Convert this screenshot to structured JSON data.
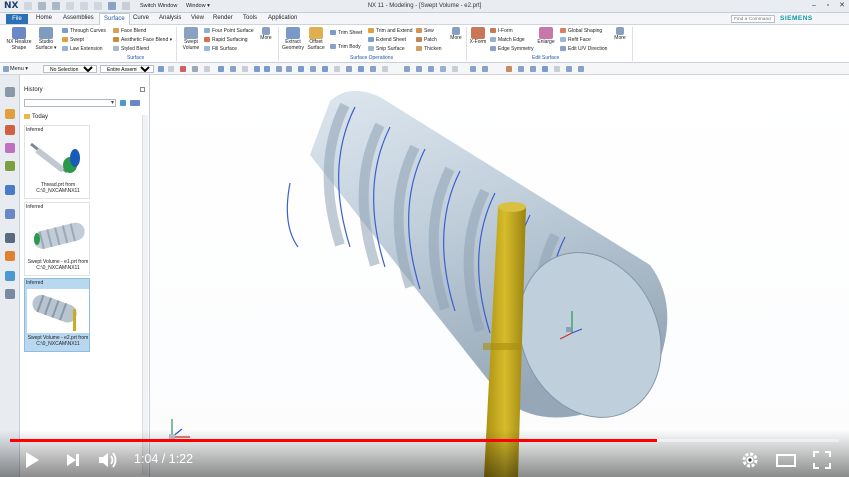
{
  "window": {
    "logo": "NX",
    "switch_window": "Switch Window",
    "window_menu": "Window ▾",
    "title": "NX 11 - Modeling - [Swept Volume - e2.prt]",
    "controls": [
      "–",
      "▫",
      "✕"
    ]
  },
  "tabs": {
    "file": "File",
    "items": [
      "Home",
      "Assemblies",
      "Surface",
      "Curve",
      "Analysis",
      "View",
      "Render",
      "Tools",
      "Application"
    ],
    "active": "Surface"
  },
  "search": {
    "placeholder": "Find a Command"
  },
  "brand": "SIEMENS",
  "ribbon": {
    "nx_realize": "NX Realize Shape",
    "studio_surface": "Studio Surface ▾",
    "through_curves": "Through Curves",
    "swept": "Swept",
    "law_extension": "Law Extension",
    "face_blend": "Face Blend",
    "aesthetic_face_blend": "Aesthetic Face Blend ▾",
    "styled_blend": "Styled Blend",
    "group_surface": "Surface",
    "swept_volume": "Swept Volume",
    "four_point_surface": "Four Point Surface",
    "rapid_surfacing": "Rapid Surfacing",
    "fill_surface": "Fill Surface",
    "more1": "More",
    "extract_geometry": "Extract Geometry",
    "offset_surface": "Offset Surface",
    "trim_sheet": "Trim Sheet",
    "trim_body": "Trim Body",
    "trim_and_extend": "Trim and Extend",
    "extend_sheet": "Extend Sheet",
    "snip_surface": "Snip Surface",
    "sew": "Sew",
    "patch": "Patch",
    "thicken": "Thicken",
    "more2": "More",
    "group_surface_operations": "Surface Operations",
    "x_form": "X-Form",
    "i_form": "I-Form",
    "match_edge": "Match Edge",
    "edge_symmetry": "Edge Symmetry",
    "enlarge": "Enlarge",
    "global_shaping": "Global Shaping",
    "refit_face": "Refit Face",
    "edit_uv_direction": "Edit U/V Direction",
    "more3": "More",
    "group_edit_surface": "Edit Surface"
  },
  "toolbar": {
    "menu": "Menu ▾",
    "selection_filter": "No Selection Filter",
    "scope": "Entire Assembly"
  },
  "history": {
    "title": "History",
    "today": "Today",
    "cards": [
      {
        "tag": "Inferred",
        "caption_1": "Thread.prt from",
        "caption_2": "C:\\0_NXCAM\\NX11"
      },
      {
        "tag": "Inferred",
        "caption_1": "Swept Volume - e1.prt from",
        "caption_2": "C:\\0_NXCAM\\NX11"
      },
      {
        "tag": "Inferred",
        "caption_1": "Swept Volume - e2.prt from",
        "caption_2": "C:\\0_NXCAM\\NX11"
      }
    ]
  },
  "video": {
    "time": "1:04 / 1:22",
    "progress": 0.78
  },
  "colors": {
    "accent": "#2a6fb8",
    "cylinder": "#c4d2df",
    "thread_line": "#3a5fd0",
    "tool": "#c9ad1a",
    "progress": "#ff0000"
  }
}
